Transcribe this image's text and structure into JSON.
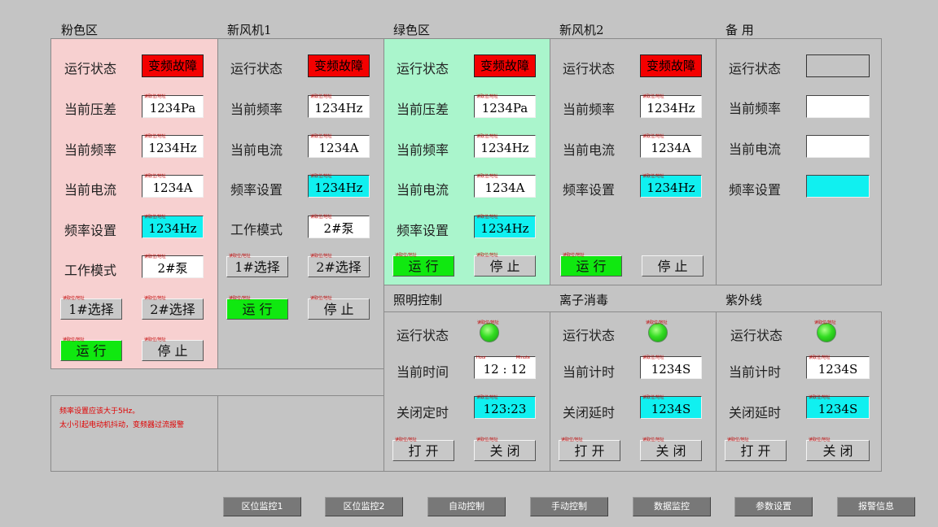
{
  "tag_text": "读取位/地址",
  "sections": {
    "pink": "粉色区",
    "fan1": "新风机1",
    "green": "绿色区",
    "fan2": "新风机2",
    "spare": "备  用",
    "lighting": "照明控制",
    "ion": "离子消毒",
    "uv": "紫外线"
  },
  "labels": {
    "run_status": "运行状态",
    "pressure": "当前压差",
    "frequency": "当前频率",
    "current": "当前电流",
    "freq_set": "频率设置",
    "work_mode": "工作模式",
    "cur_time": "当前时间",
    "close_timer": "关闭定时",
    "cur_count": "当前计时",
    "close_delay": "关闭延时"
  },
  "values": {
    "fault": "变频故障",
    "pressure": "1234Pa",
    "hz": "1234Hz",
    "amp": "1234A",
    "mode": "2#泵",
    "time": "12 : 12",
    "timer": "123:23",
    "seconds": "1234S",
    "hour_tag": "Hour",
    "minute_tag": "Minute"
  },
  "buttons": {
    "sel1": "1#选择",
    "sel2": "2#选择",
    "run": "运 行",
    "stop": "停 止",
    "open": "打 开",
    "close": "关 闭"
  },
  "notice": {
    "line1": "频率设置应该大于5Hz。",
    "line2": "太小引起电动机抖动，变频器过流报警"
  },
  "nav": [
    "区位监控1",
    "区位监控2",
    "自动控制",
    "手动控制",
    "数据监控",
    "参数设置",
    "报警信息"
  ],
  "colors": {
    "fault": "#f40000",
    "setpoint": "#10f0f0",
    "run": "#10e810",
    "pink_zone": "#f7d0d0",
    "green_zone": "#aaf5cc"
  }
}
